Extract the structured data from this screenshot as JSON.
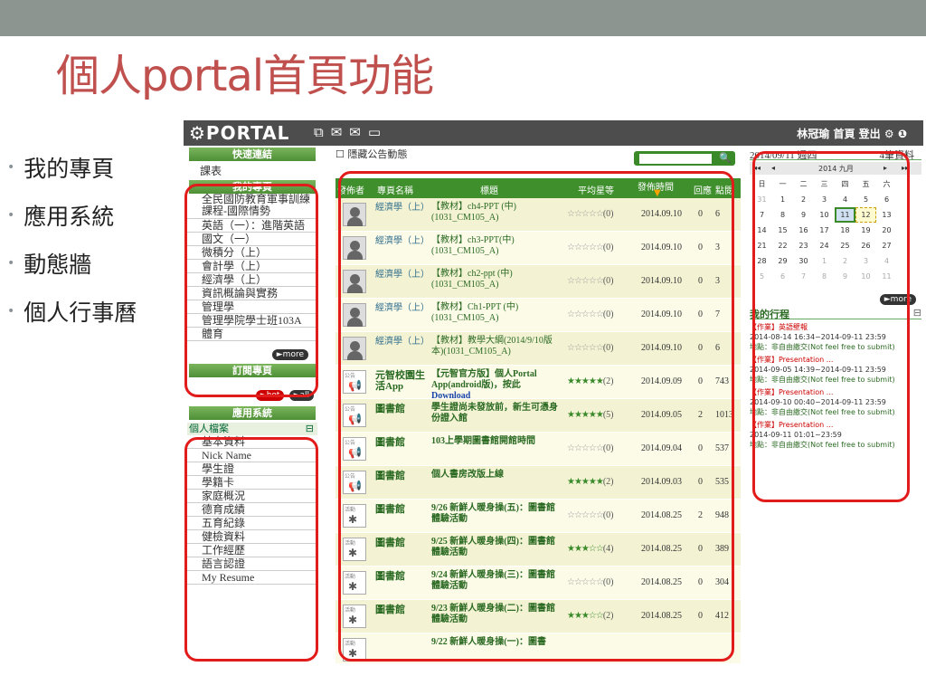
{
  "slide": {
    "title": "個人portal首頁功能",
    "bullets": [
      "我的專頁",
      "應用系統",
      "動態牆",
      "個人行事曆"
    ]
  },
  "header": {
    "logo": "⚙PORTAL",
    "icons": [
      "share-icon",
      "chat-icon",
      "mail-icon",
      "calendar-icon"
    ],
    "user": "林冠瑜",
    "home": "首頁",
    "logout": "登出"
  },
  "left": {
    "quick_links_label": "快速連結",
    "quick_item": "課表",
    "my_pages_label": "我的專頁",
    "my_pages": [
      {
        "label": "全民國防教育軍事訓練課程-國際情勢",
        "two": true
      },
      {
        "label": "英語（一）：進階英語"
      },
      {
        "label": "國文（一）"
      },
      {
        "label": "微積分（上）"
      },
      {
        "label": "會計學（上）"
      },
      {
        "label": "經濟學（上）"
      },
      {
        "label": "資訊概論與實務"
      },
      {
        "label": "管理學"
      },
      {
        "label": "管理學院學士班103A"
      },
      {
        "label": "體育"
      }
    ],
    "more": "►more",
    "subscribe_label": "訂閱專頁",
    "hot": "►hot",
    "all": "►all",
    "apps_label": "應用系統",
    "group": "個人檔案",
    "group_toggle": "⊟",
    "apps": [
      "基本資料",
      "Nick Name",
      "學生證",
      "學籍卡",
      "家庭概況",
      "德育成績",
      "五育紀錄",
      "健檢資料",
      "工作經歷",
      "語言認證",
      "My Resume"
    ]
  },
  "main": {
    "hide_label": "隱藏公告動態",
    "columns": {
      "author": "發佈者",
      "page": "專頁名稱",
      "title": "標題",
      "rating": "平均星等",
      "time": "發佈時間",
      "replies": "回應",
      "views": "點閱"
    },
    "rows": [
      {
        "kind": "person",
        "page": "經濟學（上）",
        "title": "【教材】ch4-PPT (中)(1031_CM105_A)",
        "stars": "☆☆☆☆☆",
        "count": "(0)",
        "date": "2014.09.10",
        "replies": "0",
        "views": "6"
      },
      {
        "kind": "person",
        "page": "經濟學（上）",
        "title": "【教材】ch3-PPT(中)(1031_CM105_A)",
        "stars": "☆☆☆☆☆",
        "count": "(0)",
        "date": "2014.09.10",
        "replies": "0",
        "views": "3"
      },
      {
        "kind": "person",
        "page": "經濟學（上）",
        "title": "【教材】ch2-ppt (中)(1031_CM105_A)",
        "stars": "☆☆☆☆☆",
        "count": "(0)",
        "date": "2014.09.10",
        "replies": "0",
        "views": "3"
      },
      {
        "kind": "person",
        "page": "經濟學（上）",
        "title": "【教材】Ch1-PPT (中)(1031_CM105_A)",
        "stars": "☆☆☆☆☆",
        "count": "(0)",
        "date": "2014.09.10",
        "replies": "0",
        "views": "7"
      },
      {
        "kind": "person",
        "page": "經濟學（上）",
        "title": "【教材】教學大綱(2014/9/10版本)(1031_CM105_A)",
        "stars": "☆☆☆☆☆",
        "count": "(0)",
        "date": "2014.09.10",
        "replies": "0",
        "views": "6"
      },
      {
        "kind": "ann",
        "page": "元智校園生活App",
        "title": "【元智官方版】個人Portal App(android版)，按此",
        "link": "Download",
        "stars": "★★★★★",
        "count": "(2)",
        "date": "2014.09.09",
        "replies": "0",
        "views": "743"
      },
      {
        "kind": "ann",
        "page": "圖書館",
        "title": "學生證尚未發放前，新生可憑身份證入館",
        "stars": "★★★★★",
        "count": "(5)",
        "date": "2014.09.05",
        "replies": "2",
        "views": "1013"
      },
      {
        "kind": "ann",
        "page": "圖書館",
        "title": "103上學期圖書館開館時間",
        "stars": "☆☆☆☆☆",
        "count": "(0)",
        "date": "2014.09.04",
        "replies": "0",
        "views": "537"
      },
      {
        "kind": "ann",
        "page": "圖書館",
        "title": "個人書房改版上線",
        "stars": "★★★★★",
        "count": "(2)",
        "date": "2014.09.03",
        "replies": "0",
        "views": "535"
      },
      {
        "kind": "act",
        "page": "圖書館",
        "title": "9/26 新鮮人暖身操(五)：圖書館體驗活動",
        "stars": "☆☆☆☆☆",
        "count": "(0)",
        "date": "2014.08.25",
        "replies": "2",
        "views": "948"
      },
      {
        "kind": "act",
        "page": "圖書館",
        "title": "9/25 新鮮人暖身操(四)：圖書館體驗活動",
        "stars": "★★★☆☆",
        "count": "(4)",
        "date": "2014.08.25",
        "replies": "0",
        "views": "389"
      },
      {
        "kind": "act",
        "page": "圖書館",
        "title": "9/24 新鮮人暖身操(三)：圖書館體驗活動",
        "stars": "☆☆☆☆☆",
        "count": "(0)",
        "date": "2014.08.25",
        "replies": "0",
        "views": "304"
      },
      {
        "kind": "act",
        "page": "圖書館",
        "title": "9/23 新鮮人暖身操(二)：圖書館體驗活動",
        "stars": "★★★☆☆",
        "count": "(2)",
        "date": "2014.08.25",
        "replies": "0",
        "views": "412"
      },
      {
        "kind": "act",
        "page": "",
        "title": "9/22 新鮮人暖身操(一)：圖書",
        "stars": "",
        "count": "",
        "date": "",
        "replies": "",
        "views": ""
      }
    ]
  },
  "calendar": {
    "date_label": "2014/09/11 週四",
    "count_label": "4筆資料",
    "nav_prev2": "◂◂",
    "nav_prev": "◂",
    "month": "2014 九月",
    "nav_next": "▸",
    "nav_next2": "▸▸",
    "weekdays": [
      "日",
      "一",
      "二",
      "三",
      "四",
      "五",
      "六"
    ],
    "days": [
      {
        "d": "31",
        "dim": true
      },
      {
        "d": "1"
      },
      {
        "d": "2"
      },
      {
        "d": "3"
      },
      {
        "d": "4"
      },
      {
        "d": "5"
      },
      {
        "d": "6"
      },
      {
        "d": "7"
      },
      {
        "d": "8"
      },
      {
        "d": "9"
      },
      {
        "d": "10"
      },
      {
        "d": "11",
        "today": true
      },
      {
        "d": "12",
        "sel": true
      },
      {
        "d": "13"
      },
      {
        "d": "14"
      },
      {
        "d": "15"
      },
      {
        "d": "16"
      },
      {
        "d": "17"
      },
      {
        "d": "18"
      },
      {
        "d": "19"
      },
      {
        "d": "20"
      },
      {
        "d": "21"
      },
      {
        "d": "22"
      },
      {
        "d": "23"
      },
      {
        "d": "24"
      },
      {
        "d": "25"
      },
      {
        "d": "26"
      },
      {
        "d": "27"
      },
      {
        "d": "28"
      },
      {
        "d": "29"
      },
      {
        "d": "30"
      },
      {
        "d": "1",
        "dim": true
      },
      {
        "d": "2",
        "dim": true
      },
      {
        "d": "3",
        "dim": true
      },
      {
        "d": "4",
        "dim": true
      },
      {
        "d": "5",
        "dim": true
      },
      {
        "d": "6",
        "dim": true
      },
      {
        "d": "7",
        "dim": true
      },
      {
        "d": "8",
        "dim": true
      },
      {
        "d": "9",
        "dim": true
      },
      {
        "d": "10",
        "dim": true
      },
      {
        "d": "11",
        "dim": true
      }
    ],
    "more": "►more",
    "schedule_title": "我的行程",
    "schedule_toggle": "⊟",
    "events": [
      {
        "title": "【作業】英語壁報",
        "time": "2014-08-14 16:34~2014-09-11 23:59",
        "loc": "地點：非自由繳交(Not feel free to submit)"
      },
      {
        "title": "【作業】Presentation ...",
        "time": "2014-09-05 14:39~2014-09-11 23:59",
        "loc": "地點：非自由繳交(Not feel free to submit)"
      },
      {
        "title": "【作業】Presentation ...",
        "time": "2014-09-10 00:40~2014-09-11 23:59",
        "loc": "地點：非自由繳交(Not feel free to submit)"
      },
      {
        "title": "【作業】Presentation ...",
        "time": "2014-09-11 01:01~23:59",
        "loc": "地點：非自由繳交(Not feel free to submit)"
      }
    ]
  },
  "colors": {
    "title_red": "#c0504d",
    "portal_green": "#3f8f2c",
    "highlight_red": "#e21b1b"
  }
}
